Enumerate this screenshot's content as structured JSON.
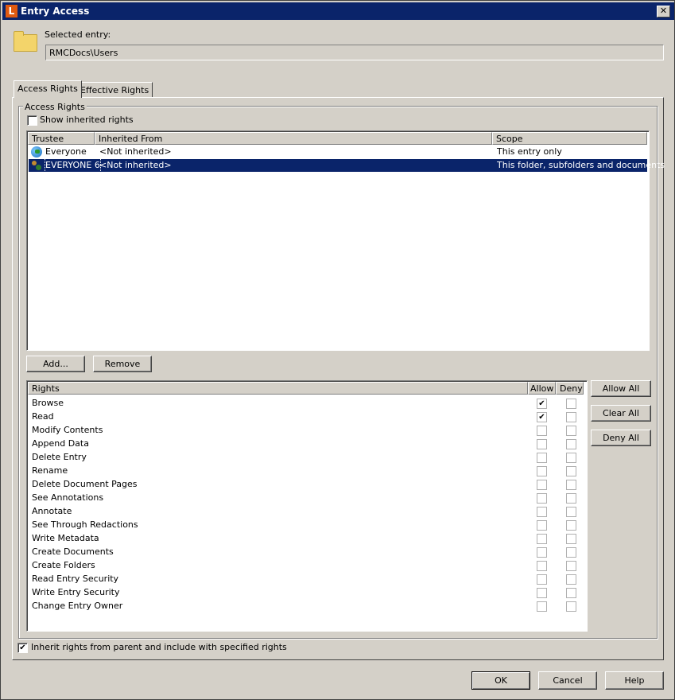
{
  "window": {
    "title": "Entry Access",
    "logo": "L",
    "close_glyph": "✕"
  },
  "selected_entry": {
    "label": "Selected entry:",
    "value": "RMCDocs\\Users"
  },
  "tabs": [
    {
      "label": "Access Rights",
      "active": true
    },
    {
      "label": "Effective Rights",
      "active": false
    }
  ],
  "access_rights": {
    "group_label": "Access Rights",
    "show_inherited": {
      "label": "Show inherited rights",
      "checked": false
    },
    "columns": [
      "Trustee",
      "Inherited From",
      "Scope"
    ],
    "rows": [
      {
        "trustee": "Everyone",
        "icon": "globe-icon",
        "inherited_from": "<Not inherited>",
        "scope": "This entry only",
        "selected": false
      },
      {
        "trustee": "EVERYONE 6",
        "icon": "users-icon",
        "inherited_from": "<Not inherited>",
        "scope": "This folder, subfolders and documents",
        "selected": true
      }
    ],
    "add_label": "Add...",
    "remove_label": "Remove"
  },
  "rights_table": {
    "columns": [
      "Rights",
      "Allow",
      "Deny"
    ],
    "rows": [
      {
        "name": "Browse",
        "allow": true,
        "deny": false
      },
      {
        "name": "Read",
        "allow": true,
        "deny": false
      },
      {
        "name": "Modify Contents",
        "allow": false,
        "deny": false
      },
      {
        "name": "Append Data",
        "allow": false,
        "deny": false
      },
      {
        "name": "Delete Entry",
        "allow": false,
        "deny": false
      },
      {
        "name": "Rename",
        "allow": false,
        "deny": false
      },
      {
        "name": "Delete Document Pages",
        "allow": false,
        "deny": false
      },
      {
        "name": "See Annotations",
        "allow": false,
        "deny": false
      },
      {
        "name": "Annotate",
        "allow": false,
        "deny": false
      },
      {
        "name": "See Through Redactions",
        "allow": false,
        "deny": false
      },
      {
        "name": "Write Metadata",
        "allow": false,
        "deny": false
      },
      {
        "name": "Create Documents",
        "allow": false,
        "deny": false
      },
      {
        "name": "Create Folders",
        "allow": false,
        "deny": false
      },
      {
        "name": "Read Entry Security",
        "allow": false,
        "deny": false
      },
      {
        "name": "Write Entry Security",
        "allow": false,
        "deny": false
      },
      {
        "name": "Change Entry Owner",
        "allow": false,
        "deny": false
      }
    ],
    "allow_all_label": "Allow All",
    "clear_all_label": "Clear All",
    "deny_all_label": "Deny All"
  },
  "inherit": {
    "label": "Inherit rights from parent and include with specified rights",
    "checked": true
  },
  "footer": {
    "ok_label": "OK",
    "cancel_label": "Cancel",
    "help_label": "Help"
  },
  "colors": {
    "titlebar": "#0a246a",
    "face": "#d4d0c8",
    "selection": "#0a246a",
    "logo": "#e05a10"
  }
}
